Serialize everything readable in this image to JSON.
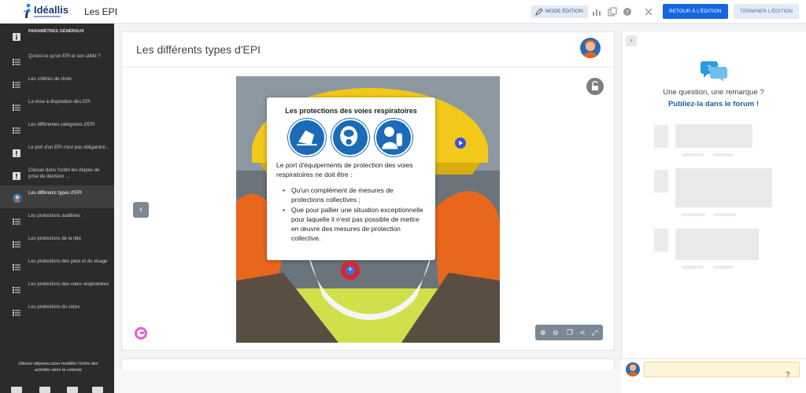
{
  "app": {
    "logo_text": "Idéallis",
    "title": "Les EPI"
  },
  "toolbar": {
    "mode_label": "MODE ÉDITION",
    "retour_label": "RETOUR À L'ÉDITION",
    "terminer_label": "TERMINER L'ÉDITION"
  },
  "sidebar": {
    "items": [
      {
        "label": "PARAMÈTRES GÉNÉRAUX",
        "icon": "info-icon"
      },
      {
        "label": "Qu'est-ce qu'un EPI et son utilité ?",
        "icon": "list-icon"
      },
      {
        "label": "Les critères de choix",
        "icon": "list-icon"
      },
      {
        "label": "La mise à disposition des EPI",
        "icon": "list-icon"
      },
      {
        "label": "Les différentes catégories d'EPI",
        "icon": "list-icon"
      },
      {
        "label": "Le port d'un EPI n'est pas obligatoire...",
        "icon": "alert-icon"
      },
      {
        "label": "Classer dans l'ordre les étapes de prise de décision ...",
        "icon": "alert-icon"
      },
      {
        "label": "Les différents types d'EPI",
        "icon": "avatar-icon"
      },
      {
        "label": "Les protections auditives",
        "icon": "list-icon"
      },
      {
        "label": "Les protections de la tête",
        "icon": "list-icon"
      },
      {
        "label": "Les protections des yeux et du visage",
        "icon": "list-icon"
      },
      {
        "label": "Les protections des voies respiratoires",
        "icon": "list-icon"
      },
      {
        "label": "Les protections du corps",
        "icon": "list-icon"
      }
    ],
    "note": "Glissez-déposez pour modifier l'ordre des activités dans la colonne"
  },
  "main": {
    "title": "Les différents types d'EPI",
    "popup": {
      "title": "Les protections des voies respiratoires",
      "icons": [
        "respirator-mask-icon",
        "full-face-mask-icon",
        "breathing-apparatus-icon"
      ],
      "lead": "Le port d'équipements de protection des voies respiratoires ne doit être :",
      "bullets": [
        "Qu'un complément de mesures de protections collectives ;",
        "Que pour pallier une situation exceptionnelle pour laquelle il n'est pas possible de mettre en œuvre des mesures de protection collective."
      ]
    }
  },
  "forum": {
    "question": "Une question, une remarque ?",
    "cta": "Publiez-la dans le forum !"
  },
  "help": "?",
  "colors": {
    "primary": "#1565e0",
    "sidebar_bg": "#2b2b2b",
    "popup_icon_blue": "#1a6bb8",
    "hotspot_red": "#d9252c"
  }
}
